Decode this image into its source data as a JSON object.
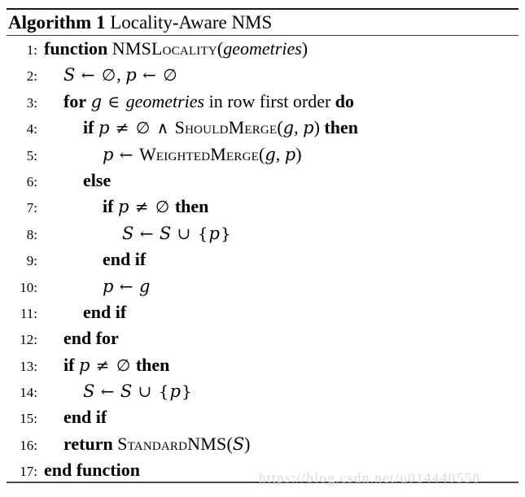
{
  "document": {
    "type": "algorithm-pseudocode",
    "title": {
      "label": "Algorithm 1",
      "name": "Locality-Aware NMS"
    },
    "watermark": "https://blog.csdn.net/u014440558",
    "colors": {
      "text": "#000000",
      "rule": "#1a1a1a",
      "watermark": "#d8d8d8",
      "background": "#ffffff"
    }
  },
  "lines": [
    {
      "number": "1:",
      "indent": 0,
      "tokens": [
        {
          "t": "function",
          "s": "kw"
        },
        {
          "t": " ",
          "s": "plain"
        },
        {
          "t": "NMSLocality",
          "s": "proc"
        },
        {
          "t": "(",
          "s": "plain"
        },
        {
          "t": "geometries",
          "s": "var"
        },
        {
          "t": ")",
          "s": "plain"
        }
      ]
    },
    {
      "number": "2:",
      "indent": 1,
      "tokens": [
        {
          "t": "S",
          "s": "mathvar"
        },
        {
          "t": " ← ",
          "s": "op"
        },
        {
          "t": "∅",
          "s": "op"
        },
        {
          "t": ", ",
          "s": "plain"
        },
        {
          "t": "p",
          "s": "mathvar"
        },
        {
          "t": " ← ",
          "s": "op"
        },
        {
          "t": "∅",
          "s": "op"
        }
      ]
    },
    {
      "number": "3:",
      "indent": 1,
      "tokens": [
        {
          "t": "for",
          "s": "kw"
        },
        {
          "t": " ",
          "s": "plain"
        },
        {
          "t": "g",
          "s": "mathvar"
        },
        {
          "t": " ∈ ",
          "s": "op"
        },
        {
          "t": "geometries",
          "s": "var"
        },
        {
          "t": " in row first order ",
          "s": "plain"
        },
        {
          "t": "do",
          "s": "kw"
        }
      ]
    },
    {
      "number": "4:",
      "indent": 2,
      "tokens": [
        {
          "t": "if",
          "s": "kw"
        },
        {
          "t": " ",
          "s": "plain"
        },
        {
          "t": "p",
          "s": "mathvar"
        },
        {
          "t": " ≠ ",
          "s": "op"
        },
        {
          "t": "∅",
          "s": "op"
        },
        {
          "t": " ∧ ",
          "s": "op"
        },
        {
          "t": "ShouldMerge",
          "s": "proc"
        },
        {
          "t": "(",
          "s": "plain"
        },
        {
          "t": "g",
          "s": "mathvar"
        },
        {
          "t": ", ",
          "s": "plain"
        },
        {
          "t": "p",
          "s": "mathvar"
        },
        {
          "t": ") ",
          "s": "plain"
        },
        {
          "t": "then",
          "s": "kw"
        }
      ]
    },
    {
      "number": "5:",
      "indent": 3,
      "tokens": [
        {
          "t": "p",
          "s": "mathvar"
        },
        {
          "t": " ← ",
          "s": "op"
        },
        {
          "t": "WeightedMerge",
          "s": "proc"
        },
        {
          "t": "(",
          "s": "plain"
        },
        {
          "t": "g",
          "s": "mathvar"
        },
        {
          "t": ", ",
          "s": "plain"
        },
        {
          "t": "p",
          "s": "mathvar"
        },
        {
          "t": ")",
          "s": "plain"
        }
      ]
    },
    {
      "number": "6:",
      "indent": 2,
      "tokens": [
        {
          "t": "else",
          "s": "kw"
        }
      ]
    },
    {
      "number": "7:",
      "indent": 3,
      "tokens": [
        {
          "t": "if",
          "s": "kw"
        },
        {
          "t": " ",
          "s": "plain"
        },
        {
          "t": "p",
          "s": "mathvar"
        },
        {
          "t": " ≠ ",
          "s": "op"
        },
        {
          "t": "∅",
          "s": "op"
        },
        {
          "t": " ",
          "s": "plain"
        },
        {
          "t": "then",
          "s": "kw"
        }
      ]
    },
    {
      "number": "8:",
      "indent": 4,
      "tokens": [
        {
          "t": "S",
          "s": "mathvar"
        },
        {
          "t": " ← ",
          "s": "op"
        },
        {
          "t": "S",
          "s": "mathvar"
        },
        {
          "t": " ∪ ",
          "s": "op"
        },
        {
          "t": "{",
          "s": "op"
        },
        {
          "t": "p",
          "s": "mathvar"
        },
        {
          "t": "}",
          "s": "op"
        }
      ]
    },
    {
      "number": "9:",
      "indent": 3,
      "tokens": [
        {
          "t": "end if",
          "s": "kw"
        }
      ]
    },
    {
      "number": "10:",
      "indent": 3,
      "tokens": [
        {
          "t": "p",
          "s": "mathvar"
        },
        {
          "t": " ← ",
          "s": "op"
        },
        {
          "t": "g",
          "s": "mathvar"
        }
      ]
    },
    {
      "number": "11:",
      "indent": 2,
      "tokens": [
        {
          "t": "end if",
          "s": "kw"
        }
      ]
    },
    {
      "number": "12:",
      "indent": 1,
      "tokens": [
        {
          "t": "end for",
          "s": "kw"
        }
      ]
    },
    {
      "number": "13:",
      "indent": 1,
      "tokens": [
        {
          "t": "if",
          "s": "kw"
        },
        {
          "t": " ",
          "s": "plain"
        },
        {
          "t": "p",
          "s": "mathvar"
        },
        {
          "t": " ≠ ",
          "s": "op"
        },
        {
          "t": "∅",
          "s": "op"
        },
        {
          "t": " ",
          "s": "plain"
        },
        {
          "t": "then",
          "s": "kw"
        }
      ]
    },
    {
      "number": "14:",
      "indent": 2,
      "tokens": [
        {
          "t": "S",
          "s": "mathvar"
        },
        {
          "t": " ← ",
          "s": "op"
        },
        {
          "t": "S",
          "s": "mathvar"
        },
        {
          "t": " ∪ ",
          "s": "op"
        },
        {
          "t": "{",
          "s": "op"
        },
        {
          "t": "p",
          "s": "mathvar"
        },
        {
          "t": "}",
          "s": "op"
        }
      ]
    },
    {
      "number": "15:",
      "indent": 1,
      "tokens": [
        {
          "t": "end if",
          "s": "kw"
        }
      ]
    },
    {
      "number": "16:",
      "indent": 1,
      "tokens": [
        {
          "t": "return",
          "s": "kw"
        },
        {
          "t": " ",
          "s": "plain"
        },
        {
          "t": "StandardNMS",
          "s": "proc"
        },
        {
          "t": "(",
          "s": "plain"
        },
        {
          "t": "S",
          "s": "mathvar"
        },
        {
          "t": ")",
          "s": "plain"
        }
      ]
    },
    {
      "number": "17:",
      "indent": 0,
      "tokens": [
        {
          "t": "end function",
          "s": "kw"
        }
      ]
    }
  ]
}
